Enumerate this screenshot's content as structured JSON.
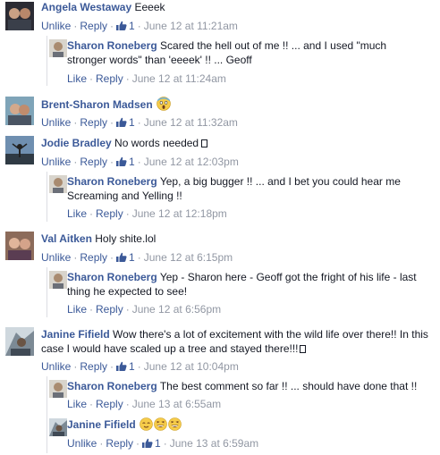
{
  "actions": {
    "unlike": "Unlike",
    "like": "Like",
    "reply": "Reply",
    "dot": "·"
  },
  "comments": [
    {
      "author": "Angela Westaway",
      "text": "Eeeek",
      "likes": "1",
      "time": "June 12 at 11:21am"
    },
    {
      "author": "Sharon Roneberg",
      "line1": "Scared the hell out of me !! ... and I used \"much",
      "line2": "stronger words\" than 'eeeek' !! ... Geoff",
      "time": "June 12 at 11:24am"
    },
    {
      "author": "Brent-Sharon Madsen",
      "likes": "1",
      "time": "June 12 at 11:32am"
    },
    {
      "author": "Jodie Bradley",
      "text": "No words needed",
      "likes": "1",
      "time": "June 12 at 12:03pm"
    },
    {
      "author": "Sharon Roneberg",
      "line1": "Yep, a big bugger !! ... and I bet you could hear me",
      "line2": "Screaming and Yelling !!",
      "time": "June 12 at 12:18pm"
    },
    {
      "author": "Val Aitken",
      "text": "Holy shite.lol",
      "likes": "1",
      "time": "June 12 at 6:15pm"
    },
    {
      "author": "Sharon Roneberg",
      "line1": "Yep - Sharon here - Geoff got the fright of his life - last",
      "line2": "thing he expected to see!",
      "time": "June 12 at 6:56pm"
    },
    {
      "author": "Janine Fifield",
      "line1": "Wow there's a lot of excitement with the wild life over there!! In this",
      "line2": "case I would have scaled up a tree and stayed there!!!",
      "likes": "1",
      "time": "June 12 at 10:04pm"
    },
    {
      "author": "Sharon Roneberg",
      "text": "The best comment so far !! ... should have done that !!",
      "time": "June 13 at 6:55am"
    },
    {
      "author": "Janine Fifield",
      "likes": "1",
      "time": "June 13 at 6:59am"
    }
  ],
  "colors": {
    "link": "#3b5998",
    "meta": "#9197a3",
    "text": "#141823",
    "rule": "#dcdee3"
  }
}
